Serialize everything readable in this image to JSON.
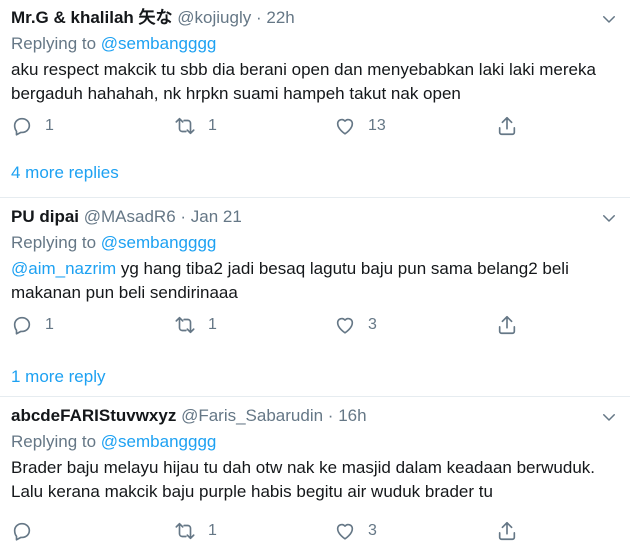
{
  "tweets": [
    {
      "name": "Mr.G & khalilah 矢な",
      "handle": "@kojiugly",
      "time": "22h",
      "replying_prefix": "Replying to",
      "replying_to": "@sembangggg",
      "mention": "",
      "text": "aku respect makcik tu sbb dia berani open dan menyebabkan laki laki mereka bergaduh hahahah, nk hrpkn suami hampeh takut nak open",
      "reply_count": "1",
      "retweet_count": "1",
      "like_count": "13",
      "more_replies": "4 more replies"
    },
    {
      "name": "PU dipai",
      "handle": "@MAsadR6",
      "time": "Jan 21",
      "replying_prefix": "Replying to",
      "replying_to": "@sembangggg",
      "mention": "@aim_nazrim",
      "text": " yg hang tiba2 jadi besaq lagutu baju pun sama belang2 beli makanan pun beli sendirinaaa",
      "reply_count": "1",
      "retweet_count": "1",
      "like_count": "3",
      "more_replies": "1 more reply"
    },
    {
      "name": "abcdeFARIStuvwxyz",
      "handle": "@Faris_Sabarudin",
      "time": "16h",
      "replying_prefix": "Replying to",
      "replying_to": "@sembangggg",
      "mention": "",
      "text": "Brader baju melayu hijau tu dah otw nak ke masjid dalam keadaan berwuduk. Lalu kerana makcik baju purple habis begitu air wuduk brader tu",
      "reply_count": "",
      "retweet_count": "1",
      "like_count": "3",
      "more_replies": ""
    }
  ],
  "separator": "·",
  "icons": {
    "caret": "chevron-down-icon",
    "reply": "reply-icon",
    "retweet": "retweet-icon",
    "like": "heart-icon",
    "share": "share-icon"
  },
  "colors": {
    "link": "#1da1f2",
    "secondary": "#657786",
    "text": "#14171a",
    "border": "#e6ecf0"
  }
}
